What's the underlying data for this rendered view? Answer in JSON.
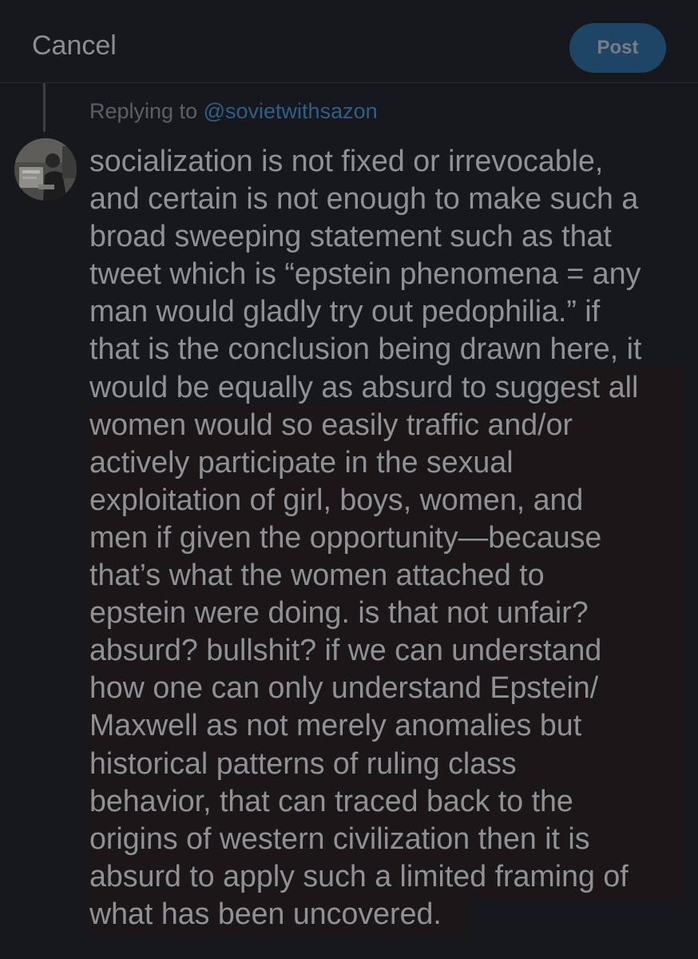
{
  "header": {
    "cancel_label": "Cancel",
    "post_label": "Post"
  },
  "reply": {
    "prefix": "Replying to",
    "handle": "@sovietwithsazon"
  },
  "draft": {
    "lines": [
      "socialization is not fixed or irrevocable,",
      "and certain is not enough to make such a",
      "broad sweeping statement such as that",
      "tweet which is “epstein phenomena = any",
      "man would gladly try out pedophilia.” if",
      "that is the conclusion being drawn here, it",
      "would be equally as absurd to suggest all",
      "women would so easily traffic and/or",
      "actively participate in the sexual",
      "exploitation of girl, boys, women, and",
      "men if given the opportunity—because",
      "that’s what the women attached to",
      "epstein were doing. is that not unfair?",
      "absurd? bullshit? if we can understand",
      "how one can only understand Epstein/",
      "Maxwell as not merely anomalies but",
      "historical patterns of ruling class",
      "behavior, that can traced back to the",
      "origins of western civilization then it is",
      "absurd to apply such a limited framing of",
      "what has been uncovered."
    ]
  },
  "colors": {
    "background": "#16181d",
    "post_button": "#1f4566",
    "handle": "#2f5f86",
    "highlight": "#1c1618"
  }
}
